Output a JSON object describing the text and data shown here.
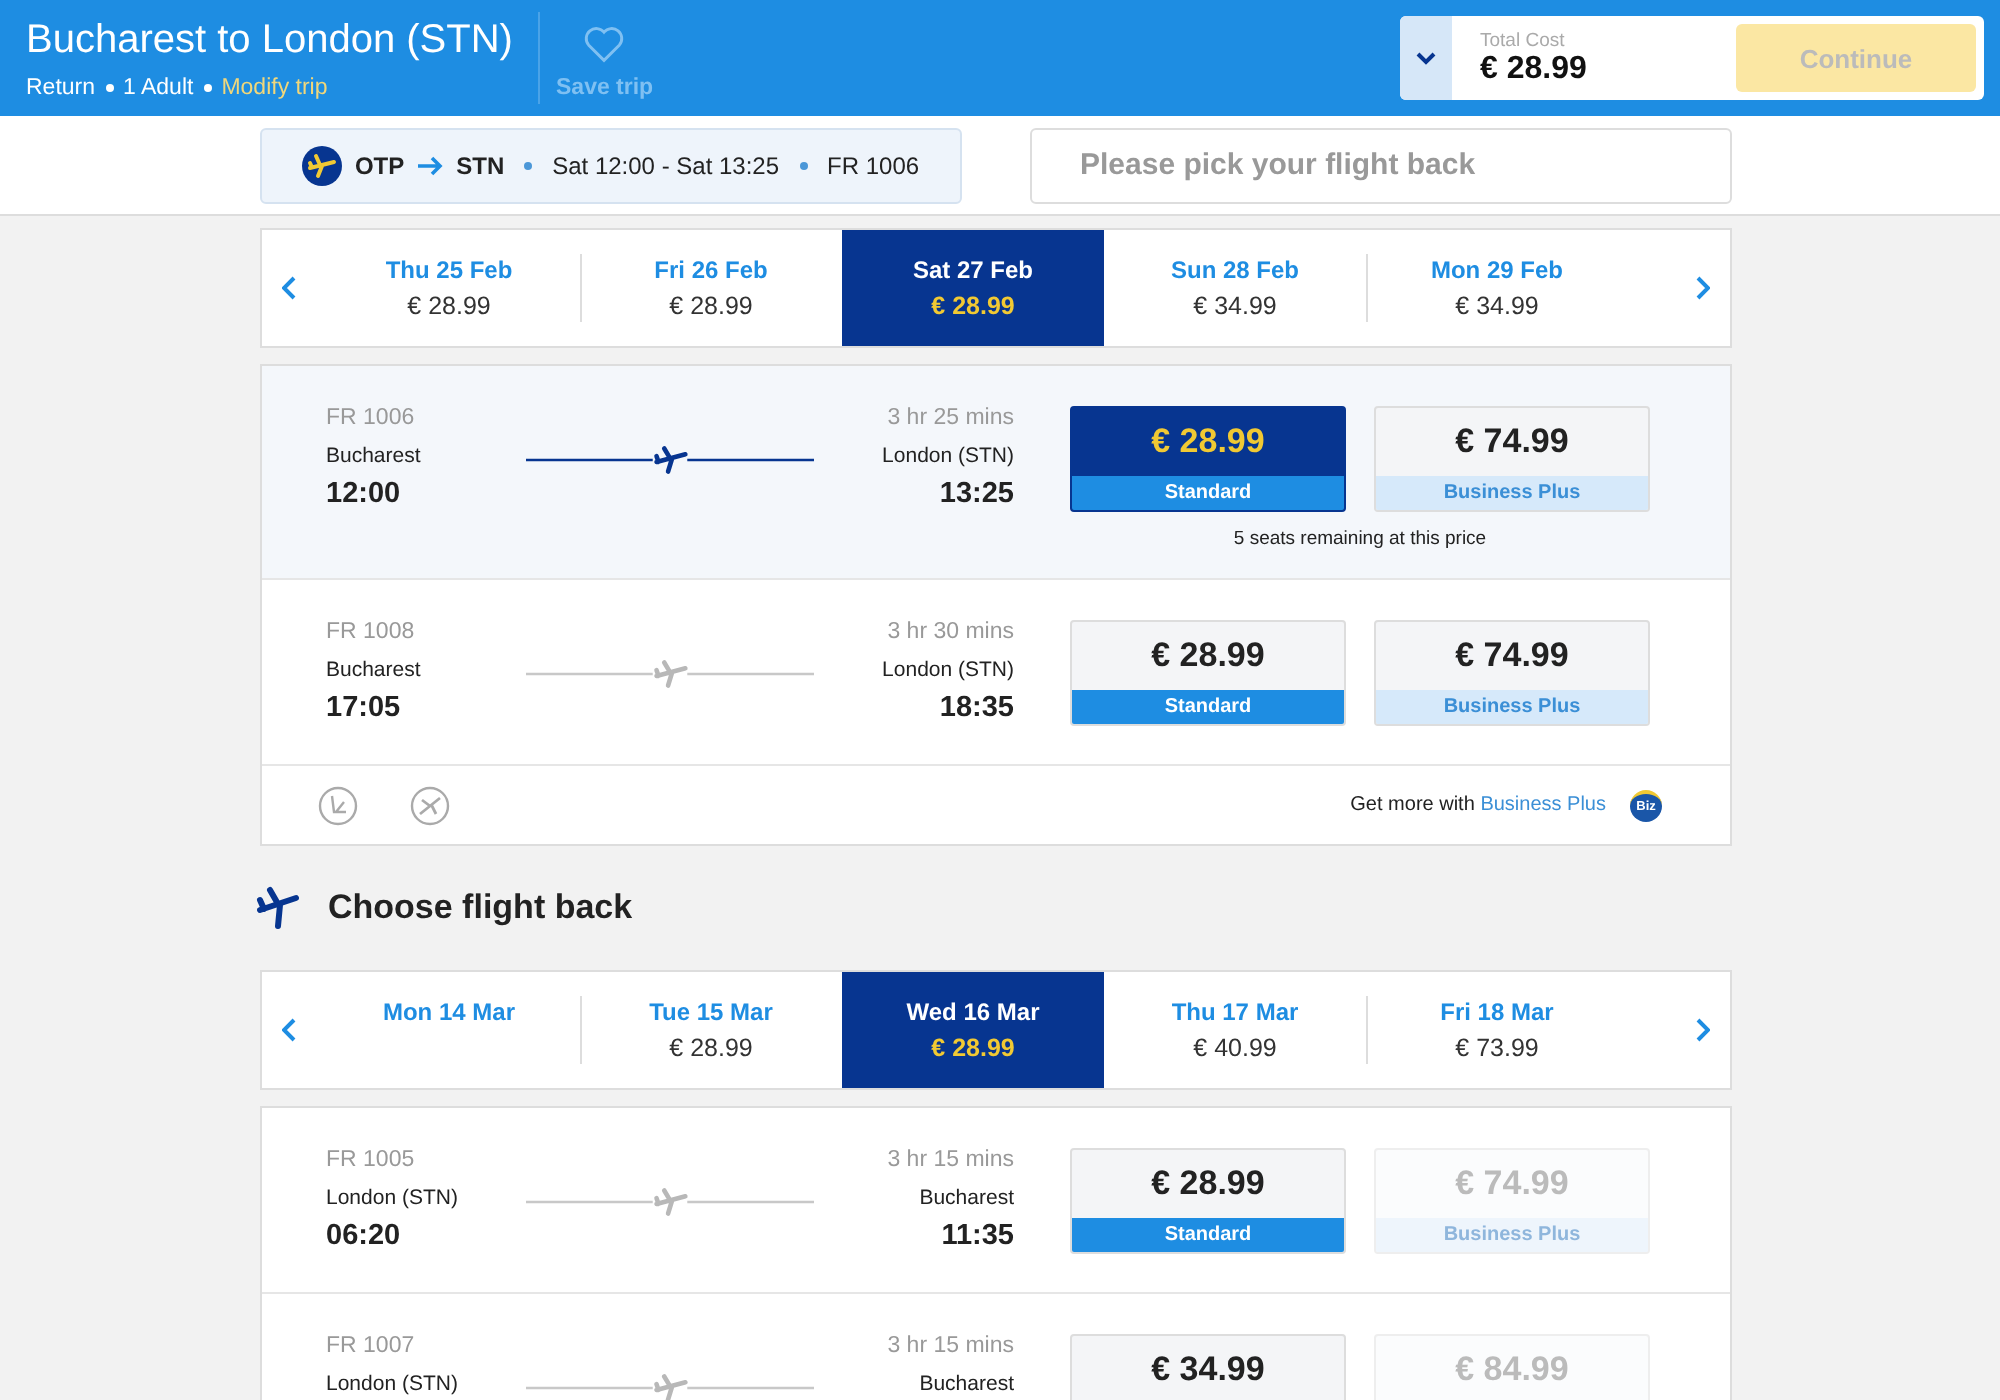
{
  "header": {
    "title": "Bucharest to London (STN)",
    "trip_type": "Return",
    "passengers": "1 Adult",
    "modify_link": "Modify trip",
    "save_trip": "Save trip",
    "total_label": "Total Cost",
    "total_value": "€ 28.99",
    "continue_button": "Continue",
    "continue_disabled": true
  },
  "summary": {
    "from": "OTP",
    "to": "STN",
    "times": "Sat 12:00 - Sat 13:25",
    "flight": "FR 1006",
    "return_prompt": "Please pick your flight back"
  },
  "outbound": {
    "dates": [
      {
        "day": "Thu 25 Feb",
        "price": "€ 28.99",
        "selected": false
      },
      {
        "day": "Fri 26 Feb",
        "price": "€ 28.99",
        "selected": false
      },
      {
        "day": "Sat 27 Feb",
        "price": "€ 28.99",
        "selected": true
      },
      {
        "day": "Sun 28 Feb",
        "price": "€ 34.99",
        "selected": false
      },
      {
        "day": "Mon 29 Feb",
        "price": "€ 34.99",
        "selected": false
      }
    ],
    "flights": [
      {
        "number": "FR 1006",
        "from": "Bucharest",
        "dep_time": "12:00",
        "duration": "3 hr 25 mins",
        "to": "London (STN)",
        "arr_time": "13:25",
        "selected": true,
        "note": "5 seats remaining at this price",
        "fares": [
          {
            "price": "€ 28.99",
            "label": "Standard",
            "selected": true,
            "disabled": false
          },
          {
            "price": "€ 74.99",
            "label": "Business Plus",
            "selected": false,
            "disabled": false
          }
        ]
      },
      {
        "number": "FR 1008",
        "from": "Bucharest",
        "dep_time": "17:05",
        "duration": "3 hr 30 mins",
        "to": "London (STN)",
        "arr_time": "18:35",
        "selected": false,
        "fares": [
          {
            "price": "€ 28.99",
            "label": "Standard",
            "selected": false,
            "disabled": false
          },
          {
            "price": "€ 74.99",
            "label": "Business Plus",
            "selected": false,
            "disabled": false
          }
        ]
      }
    ],
    "footer": {
      "text": "Get more with",
      "link": "Business Plus",
      "badge": "Biz"
    }
  },
  "return_title": "Choose flight back",
  "inbound": {
    "dates": [
      {
        "day": "Mon 14 Mar",
        "selected": false
      },
      {
        "day": "Tue 15 Mar",
        "price": "€ 28.99",
        "selected": false
      },
      {
        "day": "Wed 16 Mar",
        "price": "€ 28.99",
        "selected": true
      },
      {
        "day": "Thu 17 Mar",
        "price": "€ 40.99",
        "selected": false
      },
      {
        "day": "Fri 18 Mar",
        "price": "€ 73.99",
        "selected": false
      }
    ],
    "flights": [
      {
        "number": "FR 1005",
        "from": "London (STN)",
        "dep_time": "06:20",
        "duration": "3 hr 15 mins",
        "to": "Bucharest",
        "arr_time": "11:35",
        "selected": false,
        "fares": [
          {
            "price": "€ 28.99",
            "label": "Standard",
            "selected": false,
            "disabled": false
          },
          {
            "price": "€ 74.99",
            "label": "Business Plus",
            "selected": false,
            "disabled": true
          }
        ]
      },
      {
        "number": "FR 1007",
        "from": "London (STN)",
        "duration": "3 hr 15 mins",
        "to": "Bucharest",
        "selected": false,
        "fares": [
          {
            "price": "€ 34.99",
            "selected": false,
            "disabled": false
          },
          {
            "price": "€ 84.99",
            "selected": false,
            "disabled": true
          }
        ]
      }
    ]
  }
}
